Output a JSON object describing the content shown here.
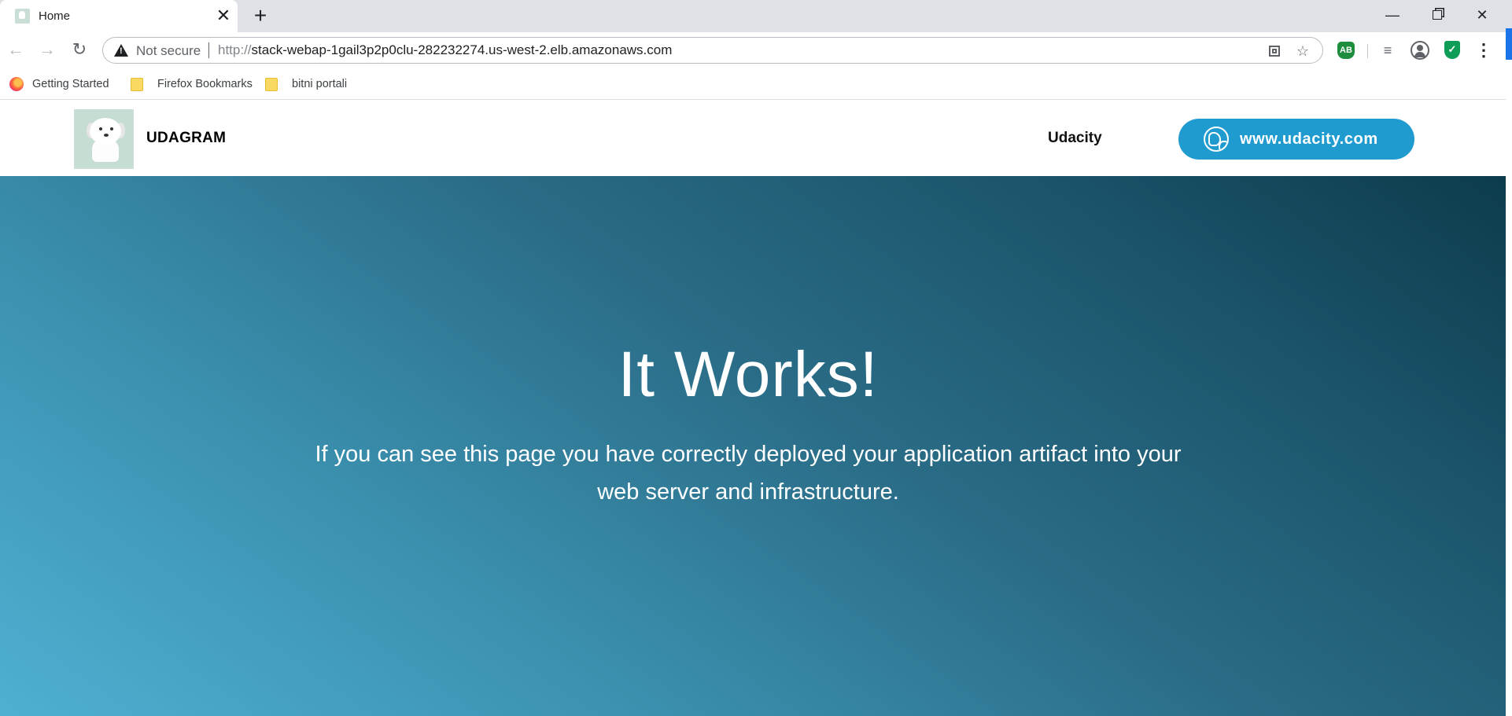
{
  "browser": {
    "tab": {
      "title": "Home",
      "close": "✕"
    },
    "new_tab": "+",
    "window": {
      "minimize": "—",
      "close": "✕"
    },
    "nav": {
      "back": "←",
      "forward": "→",
      "reload": "↻"
    },
    "omnibox": {
      "security_label": "Not secure",
      "url_scheme": "http://",
      "url_rest": "stack-webap-1gail3p2p0clu-282232274.us-west-2.elb.amazonaws.com"
    },
    "icons": {
      "star": "☆",
      "ab_ext": "AB",
      "media": "≡",
      "shield": "✓",
      "menu": "⋮"
    },
    "bookmarks": [
      {
        "label": "Getting Started",
        "icon": "firefox-icon"
      },
      {
        "label": "Firefox Bookmarks",
        "icon": "folder-icon"
      },
      {
        "label": "bitni portali",
        "icon": "folder-icon"
      }
    ]
  },
  "site": {
    "brand": "UDAGRAM",
    "nav_link": "Udacity",
    "cta": "www.udacity.com",
    "hero_title": "It Works!",
    "hero_text": "If you can see this page you have correctly deployed your application artifact into your web server and infrastructure."
  },
  "colors": {
    "cta_bg": "#1f9bd0",
    "hero_gradient_start": "#4fb0d2",
    "hero_gradient_end": "#0c3c4c"
  }
}
